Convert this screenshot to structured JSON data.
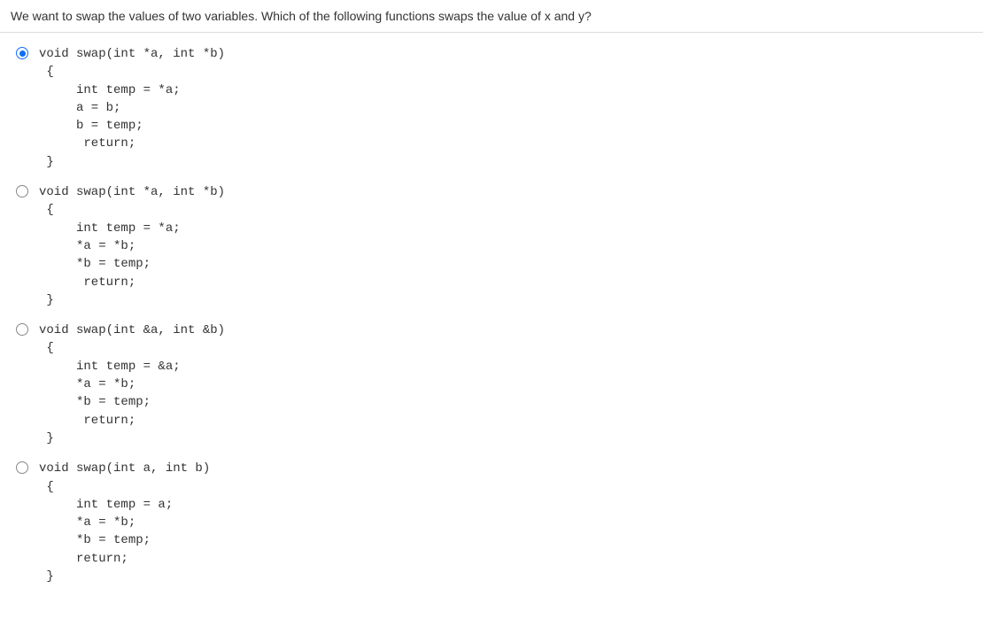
{
  "question": "We want to swap the values of two variables. Which of the following functions swaps the value of x and y?",
  "options": [
    {
      "selected": true,
      "code": "void swap(int *a, int *b)\n {\n     int temp = *a;\n     a = b;\n     b = temp;\n      return;\n }"
    },
    {
      "selected": false,
      "code": "void swap(int *a, int *b)\n {\n     int temp = *a;\n     *a = *b;\n     *b = temp;\n      return;\n }"
    },
    {
      "selected": false,
      "code": "void swap(int &a, int &b)\n {\n     int temp = &a;\n     *a = *b;\n     *b = temp;\n      return;\n }"
    },
    {
      "selected": false,
      "code": "void swap(int a, int b)\n {\n     int temp = a;\n     *a = *b;\n     *b = temp;\n     return;\n }"
    }
  ]
}
